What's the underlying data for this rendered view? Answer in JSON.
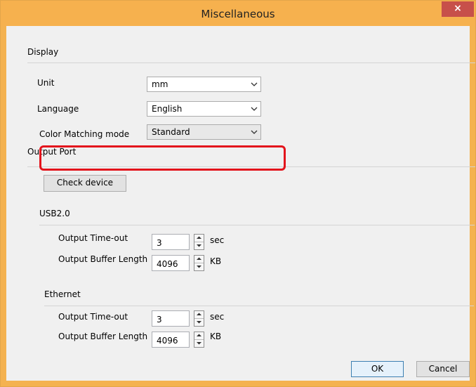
{
  "window": {
    "title": "Miscellaneous",
    "close_glyph": "×"
  },
  "display": {
    "heading": "Display",
    "unit": {
      "label": "Unit",
      "value": "mm"
    },
    "language": {
      "label": "Language",
      "value": "English"
    },
    "color_matching": {
      "label": "Color Matching mode",
      "value": "Standard"
    }
  },
  "output_port": {
    "heading": "Output Port",
    "check_device_label": "Check device",
    "usb": {
      "heading": "USB2.0",
      "timeout": {
        "label": "Output Time-out",
        "value": "3",
        "unit": "sec"
      },
      "buffer": {
        "label": "Output Buffer Length",
        "value": "4096",
        "unit": "KB"
      }
    },
    "ethernet": {
      "heading": "Ethernet",
      "timeout": {
        "label": "Output Time-out",
        "value": "3",
        "unit": "sec"
      },
      "buffer": {
        "label": "Output Buffer Length",
        "value": "4096",
        "unit": "KB"
      }
    }
  },
  "footer": {
    "ok_label": "OK",
    "cancel_label": "Cancel"
  },
  "colors": {
    "title_bar": "#f6b14e",
    "close_button": "#c7504a",
    "highlight": "#e3141c"
  },
  "icons": [
    "close-icon",
    "chevron-down-icon",
    "spin-up-icon",
    "spin-down-icon"
  ]
}
